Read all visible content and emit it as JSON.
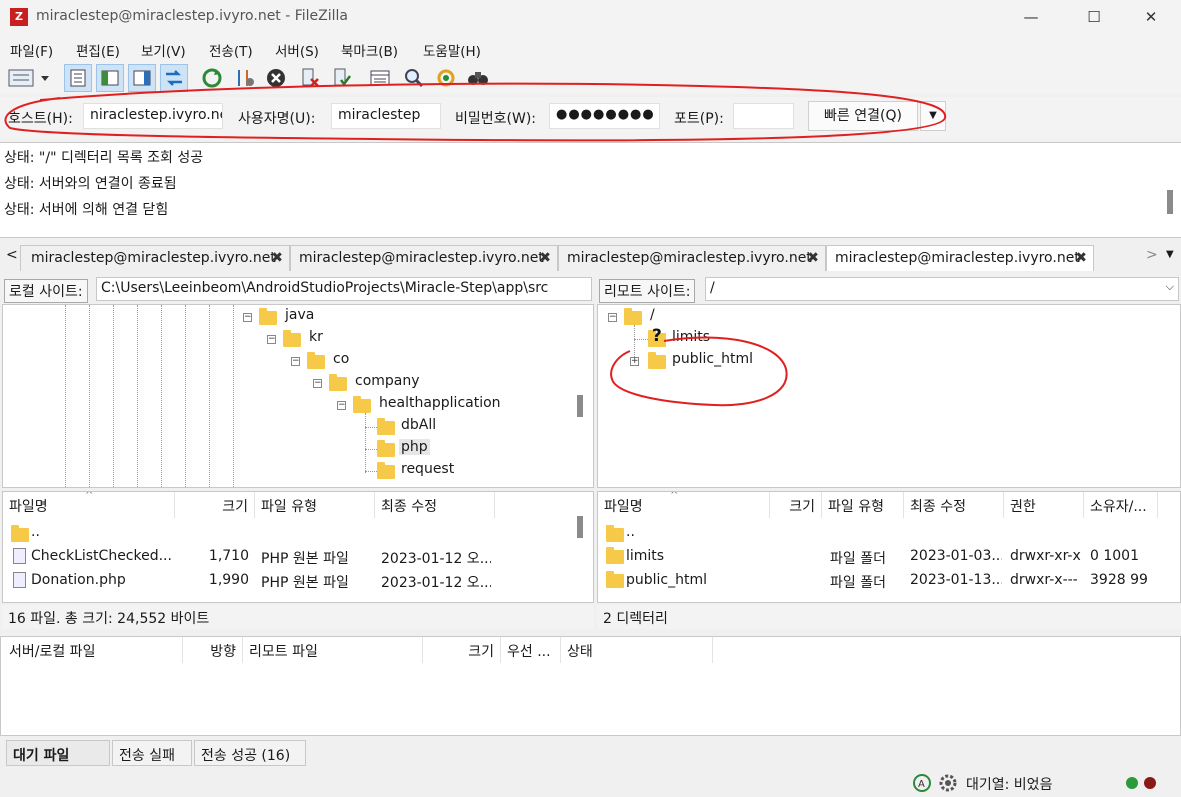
{
  "window": {
    "title": "miraclestep@miraclestep.ivyro.net - FileZilla",
    "app_icon": "Z"
  },
  "menu": [
    "파일(F)",
    "편집(E)",
    "보기(V)",
    "전송(T)",
    "서버(S)",
    "북마크(B)",
    "도움말(H)"
  ],
  "quickconnect": {
    "host_label": "호스트(H):",
    "host_value": "niraclestep.ivyro.net",
    "user_label": "사용자명(U):",
    "user_value": "miraclestep",
    "pass_label": "비밀번호(W):",
    "pass_value": "●●●●●●●●",
    "port_label": "포트(P):",
    "port_value": "",
    "button": "빠른 연결(Q)"
  },
  "log": [
    "상태:  \"/\" 디렉터리 목록 조회 성공",
    "상태:  서버와의 연결이 종료됨",
    "상태:  서버에 의해 연결 닫힘"
  ],
  "tabs": [
    "miraclestep@miraclestep.ivyro.net",
    "miraclestep@miraclestep.ivyro.net",
    "miraclestep@miraclestep.ivyro.net",
    "miraclestep@miraclestep.ivyro.net"
  ],
  "local": {
    "site_label": "로컬 사이트:",
    "path": "C:\\Users\\Leeinbeom\\AndroidStudioProjects\\Miracle-Step\\app\\src",
    "tree": [
      "java",
      "kr",
      "co",
      "company",
      "healthapplication",
      "dbAll",
      "php",
      "request"
    ],
    "headers": [
      "파일명",
      "크기",
      "파일 유형",
      "최종 수정"
    ],
    "parent": "..",
    "files": [
      {
        "name": "CheckListChecked....",
        "size": "1,710",
        "type": "PHP 원본 파일",
        "modified": "2023-01-12 오..."
      },
      {
        "name": "Donation.php",
        "size": "1,990",
        "type": "PHP 원본 파일",
        "modified": "2023-01-12 오..."
      }
    ],
    "status": "16 파일. 총 크기: 24,552 바이트"
  },
  "remote": {
    "site_label": "리모트 사이트:",
    "path": "/",
    "tree": [
      "/",
      "limits",
      "public_html"
    ],
    "headers": [
      "파일명",
      "크기",
      "파일 유형",
      "최종 수정",
      "권한",
      "소유자/..."
    ],
    "parent": "..",
    "files": [
      {
        "name": "limits",
        "size": "",
        "type": "파일 폴더",
        "modified": "2023-01-03...",
        "perm": "drwxr-xr-x",
        "owner": "0 1001"
      },
      {
        "name": "public_html",
        "size": "",
        "type": "파일 폴더",
        "modified": "2023-01-13...",
        "perm": "drwxr-x---",
        "owner": "3928 99"
      }
    ],
    "status": "2 디렉터리"
  },
  "queue": {
    "headers": [
      "서버/로컬 파일",
      "방향",
      "리모트 파일",
      "크기",
      "우선 ...",
      "상태"
    ],
    "tabs": [
      "대기 파일",
      "전송 실패",
      "전송 성공 (16)"
    ]
  },
  "statusbar": {
    "queue_text": "대기열: 비었음"
  },
  "colors": {
    "folder": "#f7c948",
    "annotation": "#e02020",
    "accent": "#0078d7"
  }
}
